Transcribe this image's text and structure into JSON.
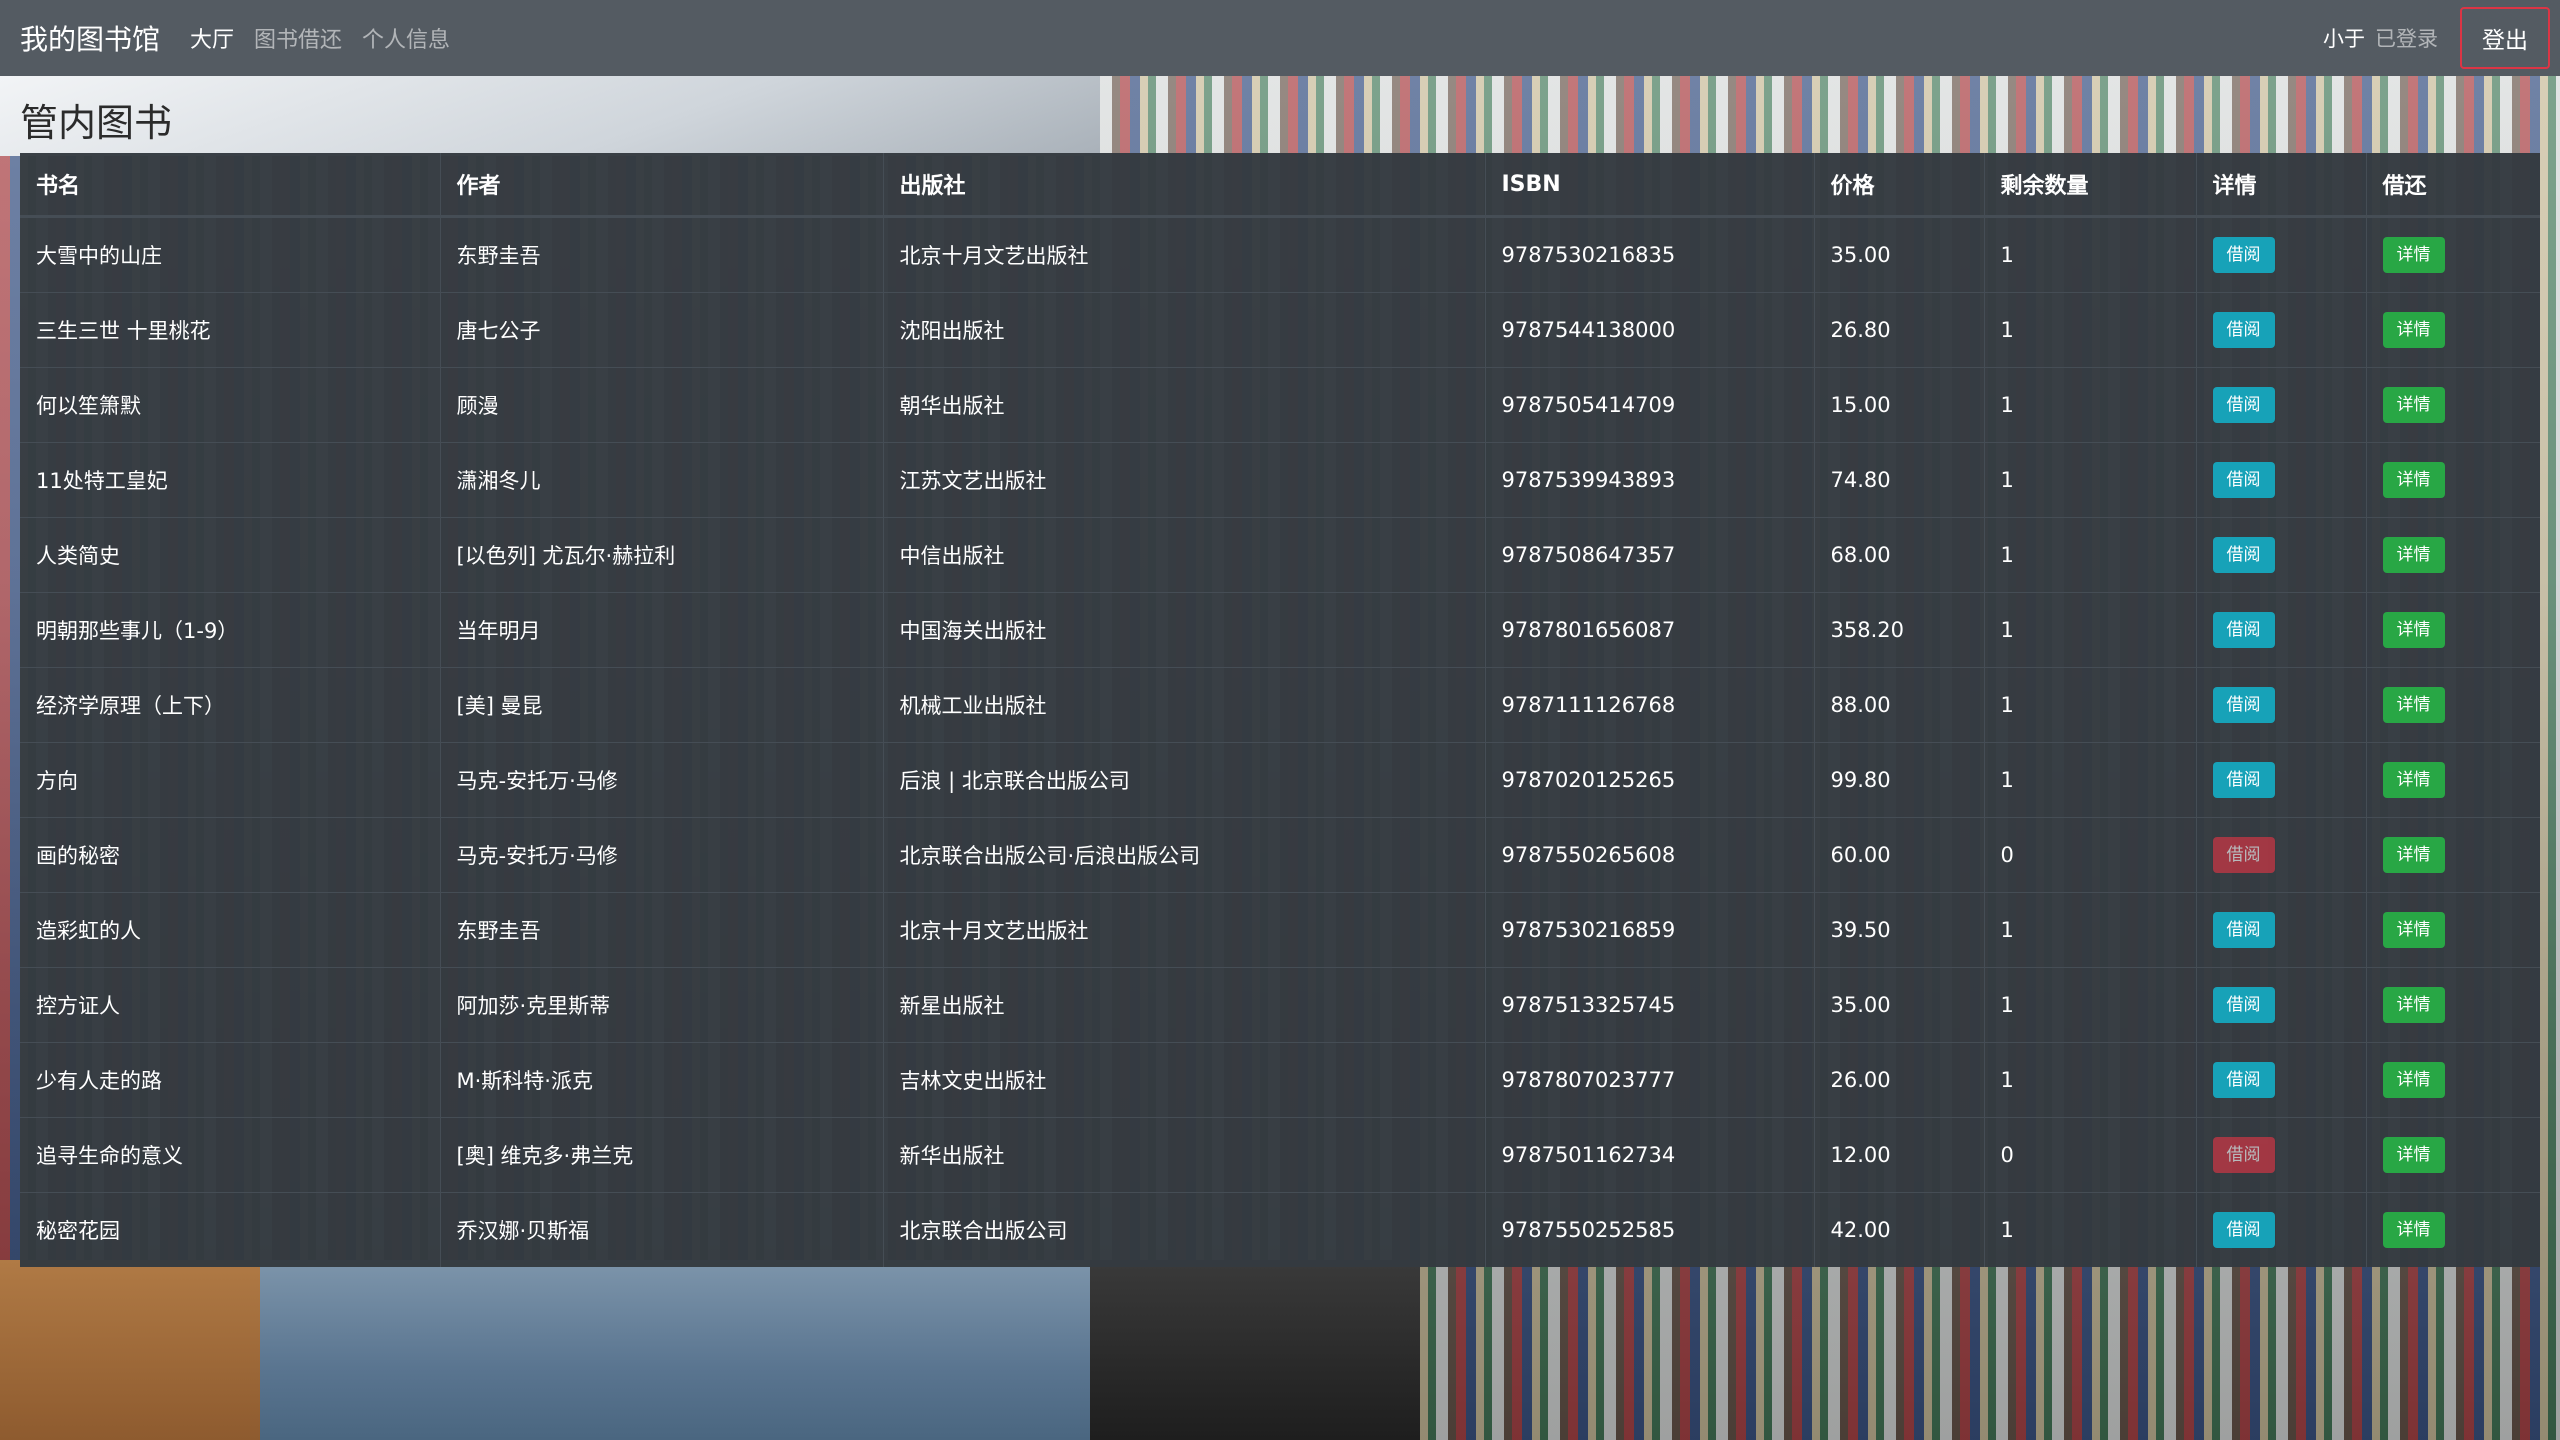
{
  "navbar": {
    "brand": "我的图书馆",
    "links": [
      {
        "label": "大厅",
        "active": true
      },
      {
        "label": "图书借还",
        "active": false
      },
      {
        "label": "个人信息",
        "active": false
      }
    ],
    "user_name": "小于",
    "user_status": "已登录",
    "logout_label": "登出"
  },
  "page_title": "管内图书",
  "table": {
    "headers": [
      "书名",
      "作者",
      "出版社",
      "ISBN",
      "价格",
      "剩余数量",
      "详情",
      "借还"
    ],
    "rows": [
      {
        "title": "大雪中的山庄",
        "author": "东野圭吾",
        "publisher": "北京十月文艺出版社",
        "isbn": "9787530216835",
        "price": "35.00",
        "remaining": "1",
        "borrow_label": "借阅",
        "borrow_state": "available",
        "detail_label": "详情"
      },
      {
        "title": "三生三世 十里桃花",
        "author": "唐七公子",
        "publisher": "沈阳出版社",
        "isbn": "9787544138000",
        "price": "26.80",
        "remaining": "1",
        "borrow_label": "借阅",
        "borrow_state": "available",
        "detail_label": "详情"
      },
      {
        "title": "何以笙箫默",
        "author": "顾漫",
        "publisher": "朝华出版社",
        "isbn": "9787505414709",
        "price": "15.00",
        "remaining": "1",
        "borrow_label": "借阅",
        "borrow_state": "available",
        "detail_label": "详情"
      },
      {
        "title": "11处特工皇妃",
        "author": "潇湘冬儿",
        "publisher": "江苏文艺出版社",
        "isbn": "9787539943893",
        "price": "74.80",
        "remaining": "1",
        "borrow_label": "借阅",
        "borrow_state": "available",
        "detail_label": "详情"
      },
      {
        "title": "人类简史",
        "author": "[以色列] 尤瓦尔·赫拉利",
        "publisher": "中信出版社",
        "isbn": "9787508647357",
        "price": "68.00",
        "remaining": "1",
        "borrow_label": "借阅",
        "borrow_state": "available",
        "detail_label": "详情"
      },
      {
        "title": "明朝那些事儿（1-9）",
        "author": "当年明月",
        "publisher": "中国海关出版社",
        "isbn": "9787801656087",
        "price": "358.20",
        "remaining": "1",
        "borrow_label": "借阅",
        "borrow_state": "available",
        "detail_label": "详情"
      },
      {
        "title": "经济学原理（上下）",
        "author": "[美] 曼昆",
        "publisher": "机械工业出版社",
        "isbn": "9787111126768",
        "price": "88.00",
        "remaining": "1",
        "borrow_label": "借阅",
        "borrow_state": "available",
        "detail_label": "详情"
      },
      {
        "title": "方向",
        "author": "马克-安托万·马修",
        "publisher": "后浪 | 北京联合出版公司",
        "isbn": "9787020125265",
        "price": "99.80",
        "remaining": "1",
        "borrow_label": "借阅",
        "borrow_state": "available",
        "detail_label": "详情"
      },
      {
        "title": "画的秘密",
        "author": "马克-安托万·马修",
        "publisher": "北京联合出版公司·后浪出版公司",
        "isbn": "9787550265608",
        "price": "60.00",
        "remaining": "0",
        "borrow_label": "借阅",
        "borrow_state": "unavailable",
        "detail_label": "详情"
      },
      {
        "title": "造彩虹的人",
        "author": "东野圭吾",
        "publisher": "北京十月文艺出版社",
        "isbn": "9787530216859",
        "price": "39.50",
        "remaining": "1",
        "borrow_label": "借阅",
        "borrow_state": "available",
        "detail_label": "详情"
      },
      {
        "title": "控方证人",
        "author": "阿加莎·克里斯蒂",
        "publisher": "新星出版社",
        "isbn": "9787513325745",
        "price": "35.00",
        "remaining": "1",
        "borrow_label": "借阅",
        "borrow_state": "available",
        "detail_label": "详情"
      },
      {
        "title": "少有人走的路",
        "author": "M·斯科特·派克",
        "publisher": "吉林文史出版社",
        "isbn": "9787807023777",
        "price": "26.00",
        "remaining": "1",
        "borrow_label": "借阅",
        "borrow_state": "available",
        "detail_label": "详情"
      },
      {
        "title": "追寻生命的意义",
        "author": "[奥] 维克多·弗兰克",
        "publisher": "新华出版社",
        "isbn": "9787501162734",
        "price": "12.00",
        "remaining": "0",
        "borrow_label": "借阅",
        "borrow_state": "unavailable",
        "detail_label": "详情"
      },
      {
        "title": "秘密花园",
        "author": "乔汉娜·贝斯福",
        "publisher": "北京联合出版公司",
        "isbn": "9787550252585",
        "price": "42.00",
        "remaining": "1",
        "borrow_label": "借阅",
        "borrow_state": "available",
        "detail_label": "详情"
      }
    ]
  },
  "colors": {
    "navbar_bg": "#545b62",
    "table_bg": "#343a40",
    "borrow_available": "#17a2b8",
    "borrow_unavailable": "#dc3545",
    "detail": "#28a745",
    "logout_border": "#dc3545"
  }
}
